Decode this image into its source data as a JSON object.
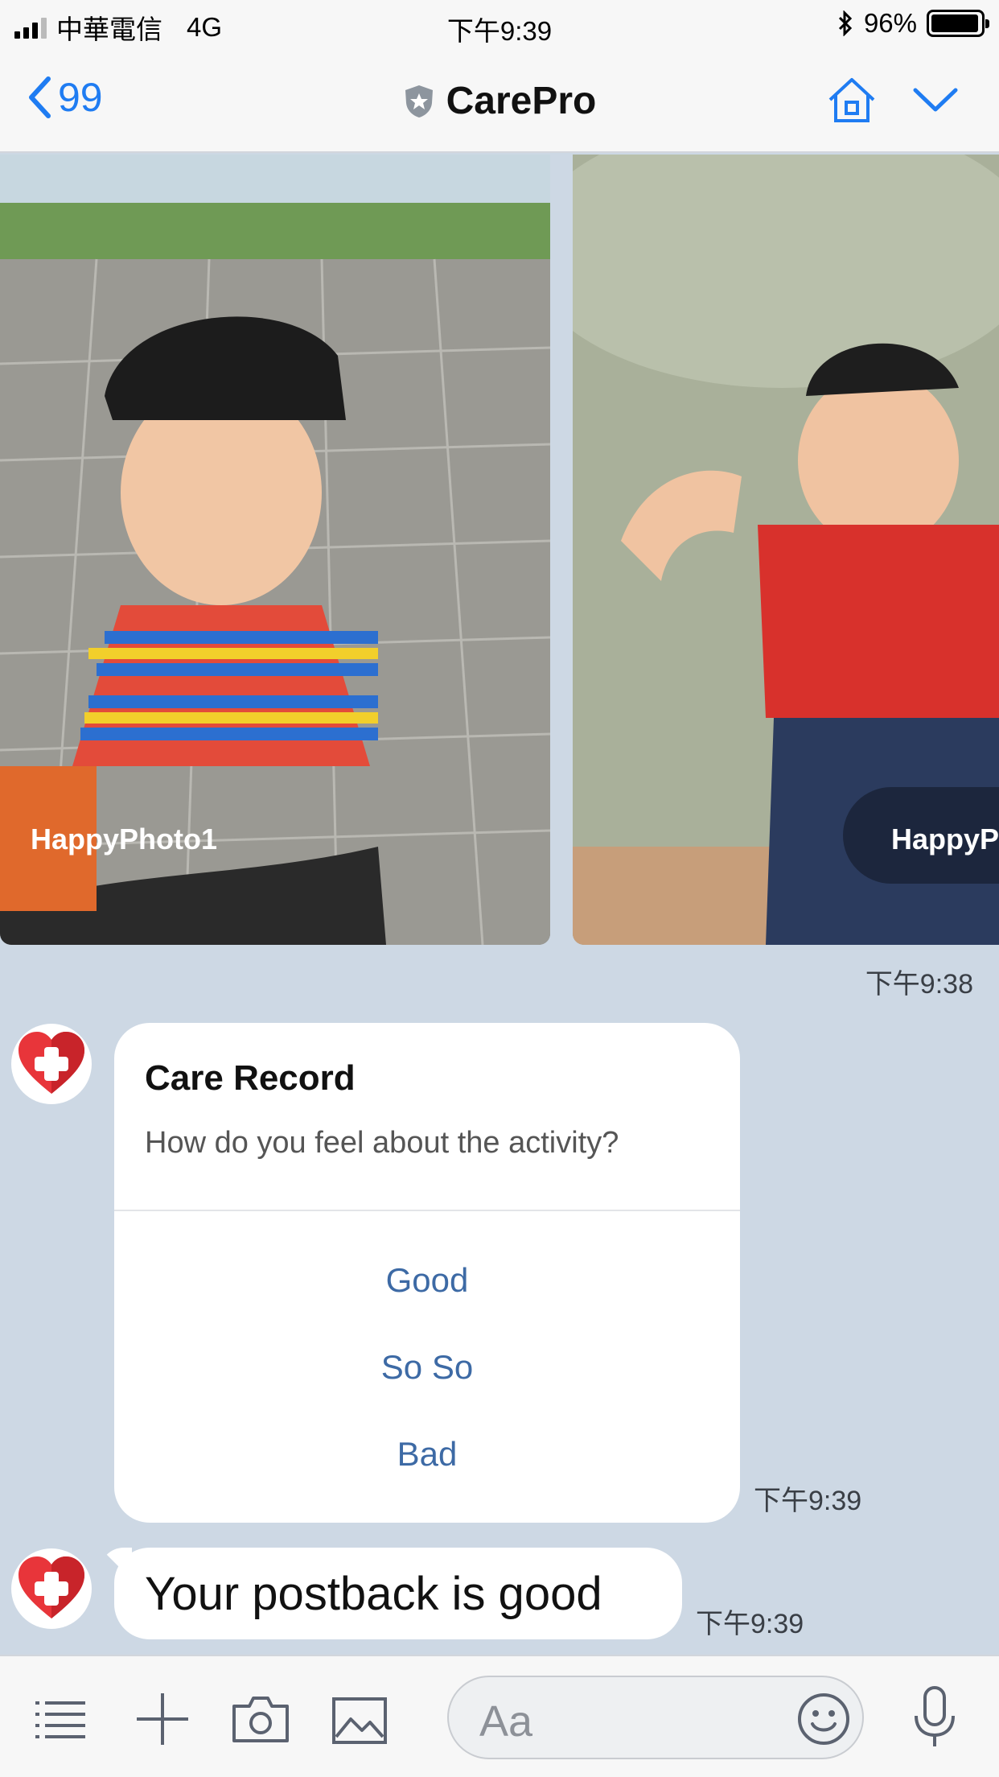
{
  "status_bar": {
    "carrier": "中華電信",
    "network": "4G",
    "time": "下午9:39",
    "battery_percent": "96%",
    "battery_level": 0.96
  },
  "nav": {
    "back_count": "99",
    "title": "CarePro",
    "accent_color": "#1f7cf2"
  },
  "carousel": {
    "items": [
      {
        "caption": "HappyPhoto1"
      },
      {
        "caption": "HappyP"
      }
    ],
    "timestamp": "下午9:38"
  },
  "care_record": {
    "title": "Care Record",
    "question": "How do you feel about the activity?",
    "options": [
      "Good",
      "So So",
      "Bad"
    ],
    "timestamp": "下午9:39"
  },
  "message": {
    "text": "Your postback is good",
    "timestamp": "下午9:39"
  },
  "input_bar": {
    "placeholder": "Aa"
  },
  "icons": {
    "menu": "list-icon",
    "add": "plus-icon",
    "camera": "camera-icon",
    "gallery": "image-icon",
    "emoji": "smiley-icon",
    "mic": "microphone-icon"
  }
}
